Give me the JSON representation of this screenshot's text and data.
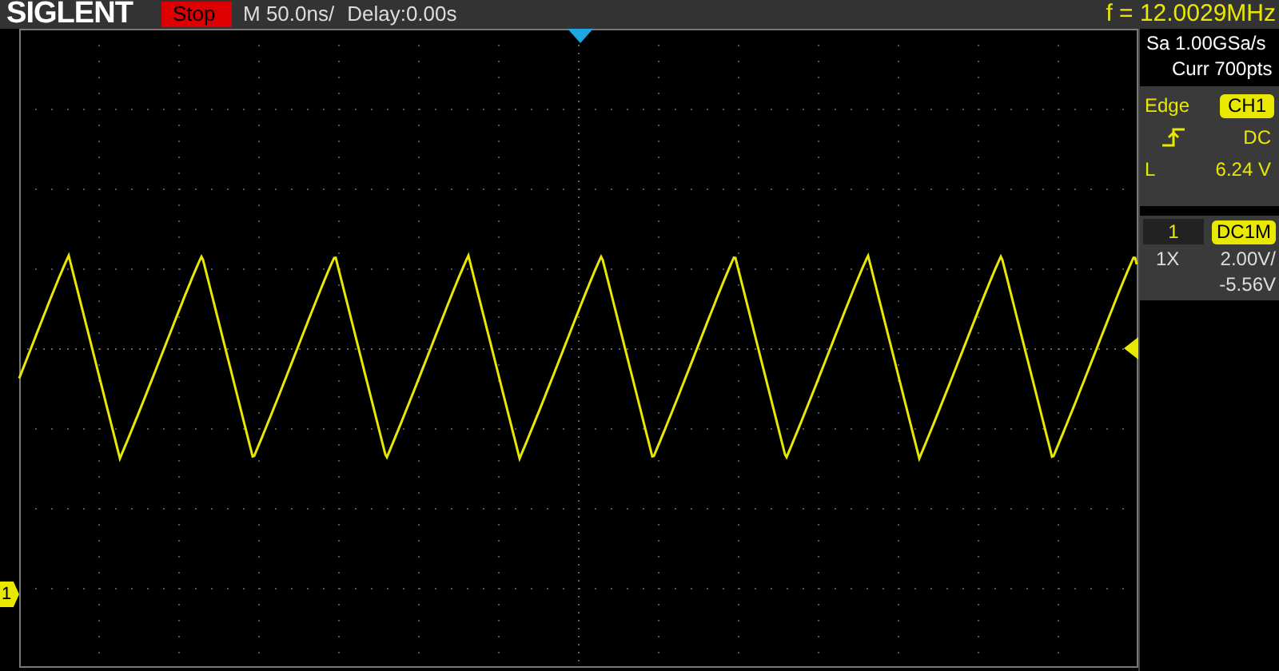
{
  "header": {
    "logo": "SIGLENT",
    "run_state": "Stop",
    "timebase": "M 50.0ns/",
    "delay": "Delay:0.00s",
    "frequency": "f = 12.0029MHz"
  },
  "acquisition": {
    "sample_rate": "Sa 1.00GSa/s",
    "memory": "Curr 700pts"
  },
  "trigger": {
    "type": "Edge",
    "source": "CH1",
    "coupling": "DC",
    "level_label": "L",
    "level": "6.24 V"
  },
  "channel": {
    "number": "1",
    "coupling": "DC1M",
    "probe": "1X",
    "scale": "2.00V/",
    "offset": "-5.56V"
  },
  "screen": {
    "channel_marker": "1"
  }
}
